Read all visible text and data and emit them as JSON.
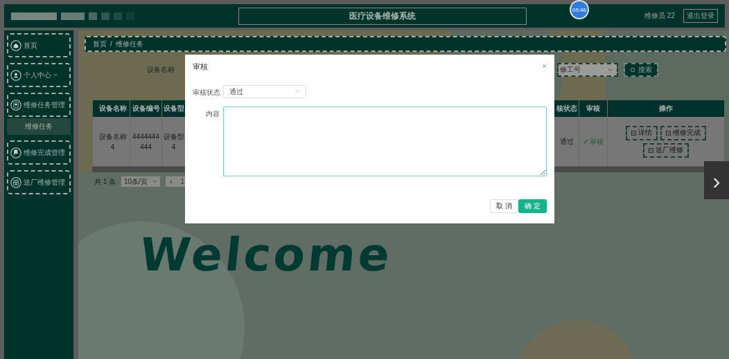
{
  "header": {
    "title": "医疗设备维修系统",
    "clock": "05:46",
    "user": "维修员 22",
    "logout": "退出登录"
  },
  "sidebar": {
    "items": [
      {
        "label": "首页",
        "selected": false
      },
      {
        "label": "个人中心",
        "selected": false,
        "expandable": true
      },
      {
        "label": "维修任务管理",
        "selected": false,
        "children": [
          {
            "label": "维修任务",
            "selected": true
          }
        ]
      },
      {
        "label": "维修完成管理",
        "selected": false
      },
      {
        "label": "送厂维修管理",
        "selected": false
      }
    ]
  },
  "breadcrumb": {
    "items": [
      "首页",
      "维修任务"
    ],
    "separator": "/"
  },
  "search": {
    "label": "设备名称",
    "select_placeholder": "修工号",
    "button": "搜索"
  },
  "table": {
    "left_columns": [
      "设备名称",
      "设备编号",
      "设备型"
    ],
    "right_columns": [
      "核状态",
      "审核",
      "操作"
    ],
    "rows": [
      {
        "left": [
          "设备名称\n4",
          "4444444\n444",
          "设备型\n4"
        ],
        "status": "通过",
        "review": "审核",
        "actions": [
          "详情",
          "维修完成",
          "送厂维修"
        ]
      }
    ]
  },
  "pagination": {
    "total": "共 1 条",
    "page_size": "10条/页",
    "prev": "‹",
    "page": "1"
  },
  "welcome": "Welcome",
  "dialog": {
    "title": "审核",
    "close": "×",
    "fields": [
      {
        "label": "审核状态",
        "kind": "select",
        "value": "通过"
      },
      {
        "label": "内容",
        "kind": "textarea"
      }
    ],
    "cancel": "取 消",
    "confirm": "确 定"
  },
  "next_arrow": "›"
}
